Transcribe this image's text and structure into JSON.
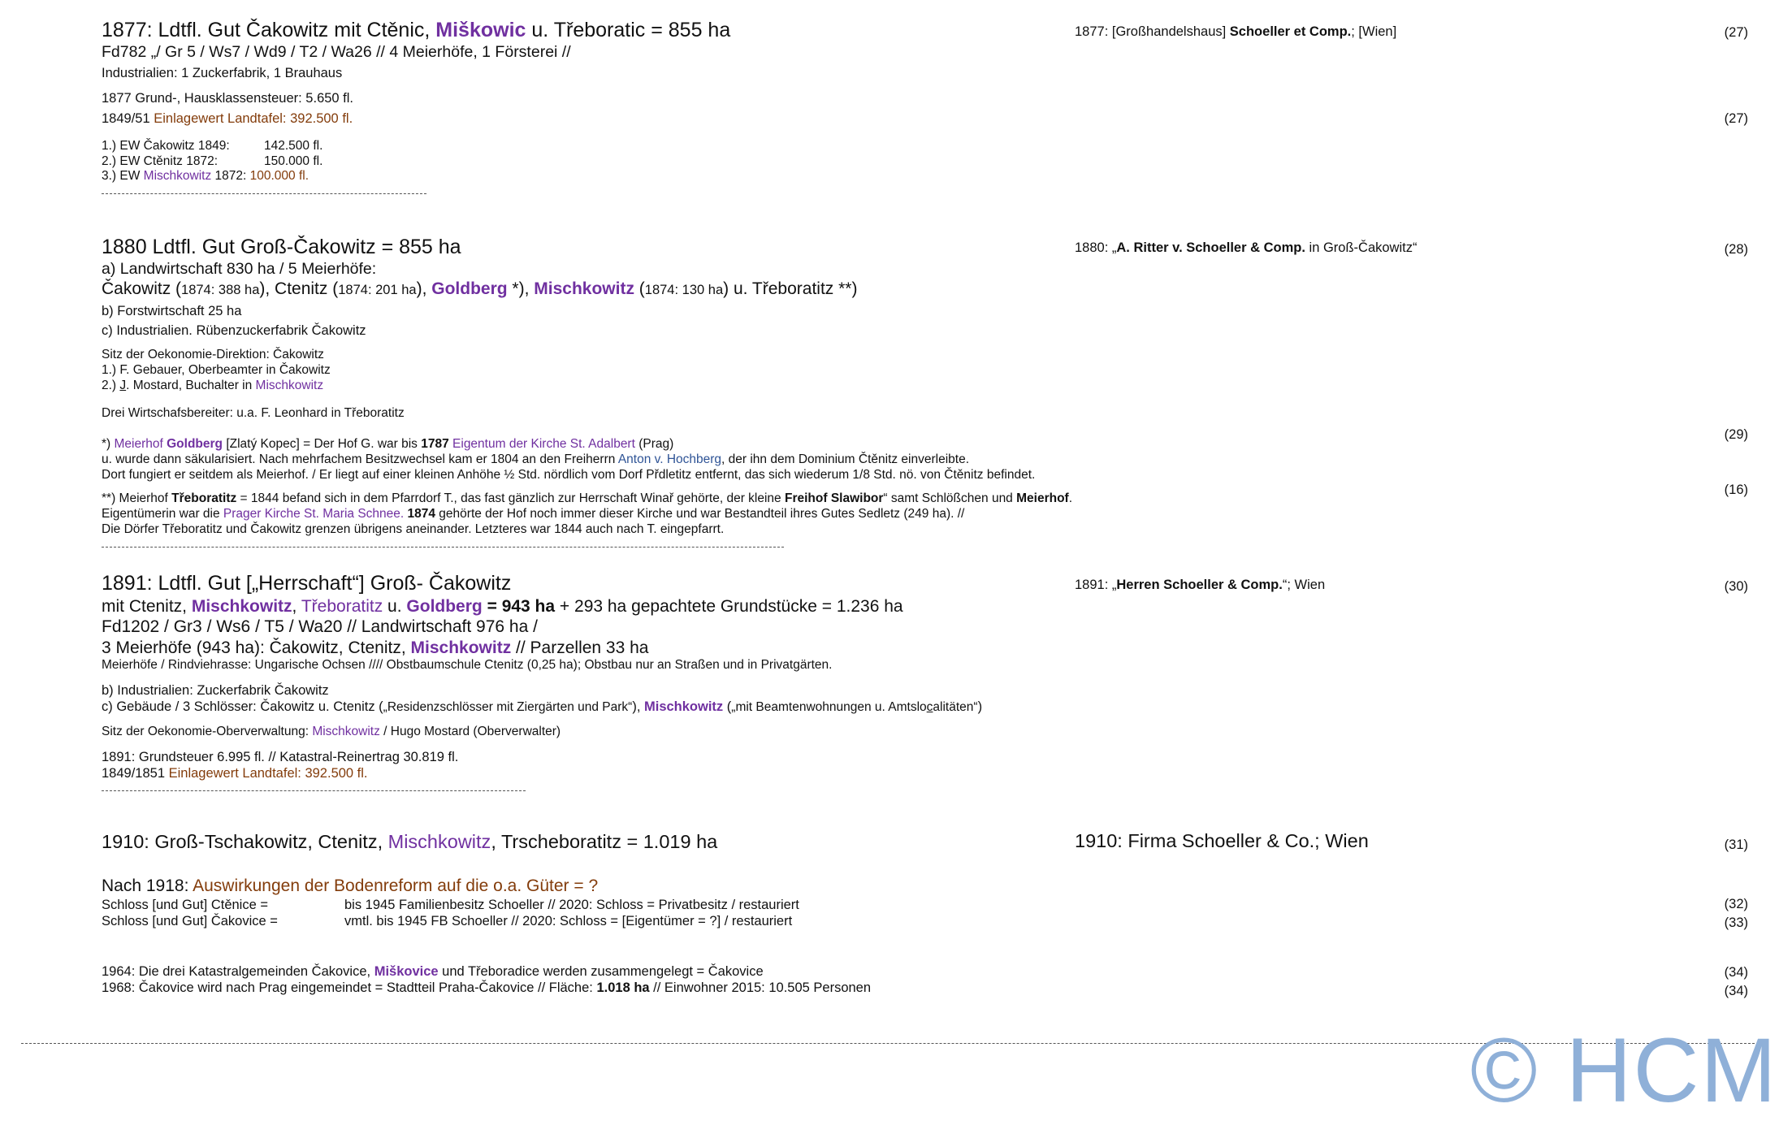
{
  "s1": {
    "title_a": "1877: Ldtfl. Gut Čakowitz mit Ctěnic, ",
    "title_b": "Miškowic",
    "title_c": " u. Třeboratic = 855 ha",
    "codes": "Fd782 „/ Gr 5 / Ws7 / Wd9 / T2 / Wa26 // 4 Meierhöfe, 1 Försterei //",
    "industry": "Industrialien: 1 Zuckerfabrik, 1 Brauhaus",
    "tax": "1877 Grund-, Hausklassensteuer: 5.650 fl.",
    "ew_a": "1849/51 ",
    "ew_b": "Einlagewert Landtafel: 392.500 fl.",
    "list1_label": "1.) EW Čakowitz 1849:",
    "list1_value": "142.500 fl.",
    "list2_label": "2.) EW Ctěnitz 1872:",
    "list2_value": "150.000 fl.",
    "list3_a": "3.) EW ",
    "list3_b": "Mischkowitz",
    "list3_c": " 1872: ",
    "list3_d": "100.000 fl.",
    "firm_a": "1877: [Großhandelshaus] ",
    "firm_b": "Schoeller et Comp.",
    "firm_c": "; [Wien]",
    "ref1": "(27)",
    "ref2": "(27)"
  },
  "s2": {
    "title": "1880 Ldtfl. Gut Groß-Čakowitz = 855 ha",
    "a": "a) Landwirtschaft 830 ha / 5 Meierhöfe:",
    "farms_a": "Čakowitz (",
    "farms_b": "1874: 388 ha",
    "farms_c": "), Ctenitz (",
    "farms_d": "1874: 201 ha",
    "farms_e": "), ",
    "farms_f": "Goldberg",
    "farms_g": " *), ",
    "farms_h": "Mischkowitz",
    "farms_i": " (",
    "farms_j": "1874: 130 ha",
    "farms_k": ") u. Třeboratitz **)",
    "b": "b) Forstwirtschaft 25 ha",
    "c": "c) Industrialien. Rübenzuckerfabrik Čakowitz",
    "seat": "Sitz der Oekonomie-Direktion: Čakowitz",
    "p1": "1.) F. Gebauer, Oberbeamter in Čakowitz",
    "p2_a": "2.) ",
    "p2_b": "J",
    "p2_c": ". Mostard, Buchalter in ",
    "p2_d": "Mischkowitz",
    "staff": "Drei Wirtschafsbereiter: u.a. F. Leonhard in Třeboratitz",
    "n1_a": "*) ",
    "n1_b": "Meierhof ",
    "n1_c": "Goldberg",
    "n1_d": " [Zlatý Kopec] = Der Hof G. war bis ",
    "n1_e": "1787",
    "n1_f": " ",
    "n1_g": "Eigentum der Kirche St. Adalbert",
    "n1_h": " (Prag)",
    "n1_l2a": "u. wurde dann säkularisiert. Nach mehrfachem Besitzwechsel kam er 1804 an den Freiherrn ",
    "n1_l2b": "Anton v. Hochberg",
    "n1_l2c": ", der ihn dem Dominium Čtěnitz einverleibte.",
    "n1_l3": "Dort fungiert er seitdem als Meierhof. / Er liegt auf einer kleinen Anhöhe ½ Std. nördlich vom Dorf Přdletitz entfernt, das sich wiederum 1/8 Std. nö. von Čtěnitz befindet.",
    "n2_a": "**) Meierhof ",
    "n2_b": "Třeboratitz",
    "n2_c": " = 1844 befand sich in dem Pfarrdorf T., das fast gänzlich zur Herrschaft Winař gehörte, der kleine ",
    "n2_d": "Freihof Slawibor",
    "n2_e": "“ samt Schlößchen und ",
    "n2_f": "Meierhof",
    "n2_g": ".",
    "n2_l2a": "Eigentümerin war die ",
    "n2_l2b": "Prager Kirche St. Maria Schnee.",
    "n2_l2c": " ",
    "n2_l2d": "1874",
    "n2_l2e": " gehörte der Hof noch immer dieser Kirche und war Bestandteil ihres Gutes Sedletz (249 ha). //",
    "n2_l3": "Die Dörfer Třeboratitz und Čakowitz grenzen übrigens aneinander. Letzteres war 1844 auch nach T. eingepfarrt.",
    "firm_a": "1880: „",
    "firm_b": "A. Ritter v. Schoeller & Comp.",
    "firm_c": " in Groß-Čakowitz“",
    "ref1": "(28)",
    "ref2": "(29)",
    "ref3": "(16)"
  },
  "s3": {
    "title": "1891: Ldtfl. Gut [„Herrschaft“] Groß- Čakowitz",
    "l2_a": "mit Ctenitz, ",
    "l2_b": "Mischkowitz",
    "l2_c": ", ",
    "l2_d": "Třeboratitz",
    "l2_e": " u. ",
    "l2_f": "Goldberg",
    "l2_g": " = ",
    "l2_h": "943 ha",
    "l2_i": " + 293 ha gepachtete Grundstücke = 1.236 ha",
    "l3": "Fd1202 / Gr3 / Ws6 / T5 / Wa20 // Landwirtschaft 976 ha /",
    "l4_a": "3 Meierhöfe (943 ha): Čakowitz, Ctenitz, ",
    "l4_b": "Mischkowitz",
    "l4_c": " // Parzellen 33 ha",
    "l5": "Meierhöfe / Rindviehrasse: Ungarische Ochsen //// Obstbaumschule Ctenitz (0,25 ha); Obstbau nur an Straßen und in Privatgärten.",
    "b": "b) Industrialien: Zuckerfabrik Čakowitz",
    "c_a": "c) Gebäude / 3 Schlösser: Čakowitz u. Ctenitz (",
    "c_b": "„Residenzschlösser mit Ziergärten und Park“",
    "c_c": "), ",
    "c_d": "Mischkowitz",
    "c_e": " (",
    "c_f": "„mit Beamtenwohnungen u. Amtslo",
    "c_g": "c",
    "c_h": "alitäten“",
    "c_i": ")",
    "seat_a": "Sitz der Oekonomie-Oberverwaltung: ",
    "seat_b": "Mischkowitz",
    "seat_c": " / Hugo Mostard (Oberverwalter)",
    "tax": "1891: Grundsteuer 6.995 fl. // Katastral-Reinertrag 30.819 fl.",
    "ew_a": "1849/1851 ",
    "ew_b": "Einlagewert Landtafel: 392.500 fl.",
    "firm_a": "1891: „",
    "firm_b": "Herren Schoeller & Comp.",
    "firm_c": "“; Wien",
    "ref1": "(30)"
  },
  "s4": {
    "title_a": "1910: Groß-Tschakowitz, Ctenitz, ",
    "title_b": "Mischkowitz",
    "title_c": ", Trscheboratitz = 1.019 ha",
    "firm": "1910: Firma Schoeller & Co.; Wien",
    "ref1": "(31)"
  },
  "s5": {
    "head_a": "Nach 1918: ",
    "head_b": "Auswirkungen der Bodenreform auf die o.a. Güter = ?",
    "r1_label": "Schloss [und Gut] Ctěnice =",
    "r1_text": "bis 1945 Familienbesitz Schoeller // 2020: Schloss = Privatbesitz / restauriert",
    "r2_label": "Schloss [und Gut] Čakovice =",
    "r2_text": "vmtl. bis 1945 FB Schoeller // 2020: Schloss = [Eigentümer = ?] / restauriert",
    "l1964_a": "1964: Die drei Katastralgemeinden Čakovice, ",
    "l1964_b": "Miškovice",
    "l1964_c": " und Třeboradice werden zusammengelegt = Čakovice",
    "l1968_a": "1968: Čakovice wird nach Prag eingemeindet = Stadtteil Praha-Čakovice // Fläche: ",
    "l1968_b": "1.018 ha",
    "l1968_c": " // Einwohner 2015: 10.505 Personen",
    "ref1": "(32)",
    "ref2": "(33)",
    "ref3": "(34)",
    "ref4": "(34)"
  },
  "watermark": "© HCM"
}
